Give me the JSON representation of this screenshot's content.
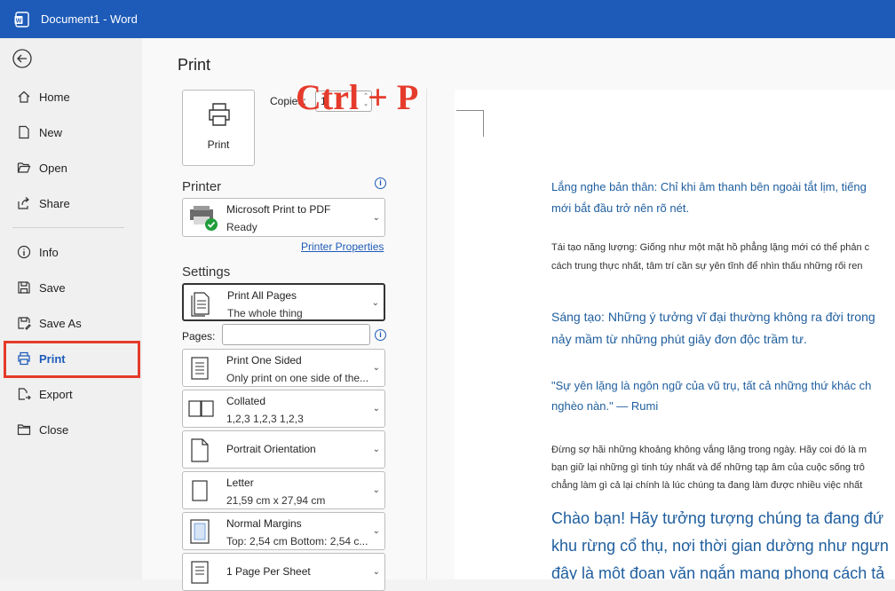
{
  "titlebar": {
    "title": "Document1  -  Word",
    "app_icon": "word-icon"
  },
  "nav": {
    "back_icon": "arrow-left-circle-icon",
    "items": [
      {
        "label": "Home",
        "icon": "home-icon"
      },
      {
        "label": "New",
        "icon": "new-doc-icon"
      },
      {
        "label": "Open",
        "icon": "folder-open-icon"
      },
      {
        "label": "Share",
        "icon": "share-icon"
      },
      {
        "label": "Info",
        "icon": "info-icon"
      },
      {
        "label": "Save",
        "icon": "save-icon"
      },
      {
        "label": "Save As",
        "icon": "save-as-icon"
      },
      {
        "label": "Print",
        "icon": "printer-icon",
        "active": true
      },
      {
        "label": "Export",
        "icon": "export-icon"
      },
      {
        "label": "Close",
        "icon": "folder-close-icon"
      }
    ]
  },
  "print": {
    "page_title": "Print",
    "button_label": "Print",
    "copies_label": "Copies:",
    "copies_value": "1",
    "printer_heading": "Printer",
    "printer_name": "Microsoft Print to PDF",
    "printer_status": "Ready",
    "printer_properties": "Printer Properties",
    "settings_heading": "Settings",
    "pages_label": "Pages:",
    "settings": [
      {
        "l1": "Print All Pages",
        "l2": "The whole thing"
      },
      {
        "l1": "Print One Sided",
        "l2": "Only print on one side of the..."
      },
      {
        "l1": "Collated",
        "l2": "1,2,3    1,2,3    1,2,3"
      },
      {
        "l1": "Portrait Orientation",
        "l2": ""
      },
      {
        "l1": "Letter",
        "l2": "21,59 cm x 27,94 cm"
      },
      {
        "l1": "Normal Margins",
        "l2": "Top: 2,54 cm Bottom: 2,54 c..."
      },
      {
        "l1": "1 Page Per Sheet",
        "l2": ""
      }
    ]
  },
  "preview": {
    "overlay": "Ctrl + P",
    "p1_l1": "Lắng nghe bản thân: Chỉ khi âm thanh bên ngoài tắt lịm, tiếng",
    "p1_l2": "mới bắt đầu trở nên rõ nét.",
    "p2_l1": "Tái tạo năng lượng: Giống như một mặt hồ phẳng lặng mới có thể phản c",
    "p2_l2": "cách trung thực nhất, tâm trí cần sự yên tĩnh để nhìn thấu những rối ren",
    "p3_l1": "Sáng tạo: Những ý tưởng vĩ đại thường không ra đời trong",
    "p3_l2": "nảy mầm từ những phút giây đơn độc trầm tư.",
    "p4_l1": "\"Sự yên lặng là ngôn ngữ của vũ trụ, tất cả những thứ khác ch",
    "p4_l2": "nghèo nàn.\" — Rumi",
    "p5_l1": "Đừng sợ hãi những khoảng không vắng lặng trong ngày. Hãy coi đó là m",
    "p5_l2": "bạn giữ lại những gì tinh túy nhất và để những tạp âm của cuộc sống trô",
    "p5_l3": "chẳng làm gì cả lại chính là lúc chúng ta đang làm được nhiều việc nhất",
    "p6_l1": "Chào bạn! Hãy tưởng tượng chúng ta đang đứ",
    "p6_l2": "khu rừng cổ thụ, nơi thời gian dường như ngưn",
    "p6_l3": "đây là một đoạn văn ngắn mang phong cách tả"
  }
}
